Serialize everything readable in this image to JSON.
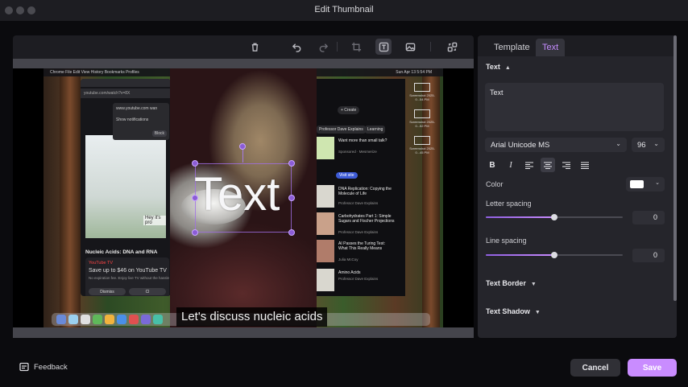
{
  "window": {
    "title": "Edit Thumbnail"
  },
  "toolbar": {
    "tools": [
      "trash-icon",
      "undo-icon",
      "redo-icon",
      "crop-icon",
      "text-tool-icon",
      "image-icon",
      "replace-icon"
    ],
    "active_tool": "text-tool-icon"
  },
  "canvas": {
    "overlay_text": "Text",
    "caption": "Let's discuss nucleic acids",
    "screenshot": {
      "menu": "Chrome   File   Edit   View   History   Bookmarks   Profiles",
      "menu_time": "Sun Apr 13  5:54 PM",
      "url": "youtube.com/watch?v=8X",
      "notification_site": "www.youtube.com wan",
      "notification_text": "Show notifications",
      "notification_button": "Block",
      "video_subtitle": "Hey it's pro",
      "video_title": "Nucleic Acids: DNA and RNA",
      "ytv_logo": "YouTube TV",
      "ytv_offer": "Save up to $46 on YouTube TV",
      "ytv_note": "No expiration fee. Enjoy live TV without the hassle",
      "ytv_dismiss": "Dismiss",
      "ytv_claim": "Cl",
      "create": "+ Create",
      "chips": [
        "Professor Dave Explains",
        "Learning"
      ],
      "feed": [
        {
          "title": "Want more than small talk?",
          "sub": "Sponsored · Mesmerize"
        },
        {
          "title": "DNA Replication: Copying the Molecule of Life",
          "sub": "Professor Dave Explains"
        },
        {
          "title": "Carbohydrates Part 1: Simple Sugars and Fischer Projections",
          "sub": "Professor Dave Explains"
        },
        {
          "title": "AI Passes the Turing Test: What This Really Means",
          "sub": "Julia McCoy"
        },
        {
          "title": "Amino Acids",
          "sub": "Professor Dave Explains"
        }
      ],
      "ad_button": "Visit site",
      "screens": [
        "Screenshot 2025-0...54 PM",
        "Screenshot 2025-0...52 PM",
        "Screenshot 2025-0...45 PM"
      ]
    }
  },
  "panel": {
    "tabs": [
      {
        "label": "Template",
        "active": false
      },
      {
        "label": "Text",
        "active": true
      }
    ],
    "text_section": {
      "title": "Text",
      "value": "Text"
    },
    "font": {
      "family": "Arial Unicode MS",
      "size": "96"
    },
    "format_buttons": [
      "bold-icon",
      "italic-icon",
      "align-left-icon",
      "align-center-icon",
      "align-right-icon",
      "align-justify-icon"
    ],
    "active_format": "align-center-icon",
    "color": {
      "label": "Color",
      "value": "#ffffff"
    },
    "letter_spacing": {
      "label": "Letter spacing",
      "value": "0",
      "level": 0.5
    },
    "line_spacing": {
      "label": "Line spacing",
      "value": "0",
      "level": 0.5
    },
    "text_border": "Text Border",
    "text_shadow": "Text Shadow"
  },
  "footer": {
    "feedback": "Feedback",
    "cancel": "Cancel",
    "save": "Save"
  },
  "colors": {
    "accent": "#c98cff",
    "panel": "#1d1d22",
    "background": "#0b0b0e"
  }
}
